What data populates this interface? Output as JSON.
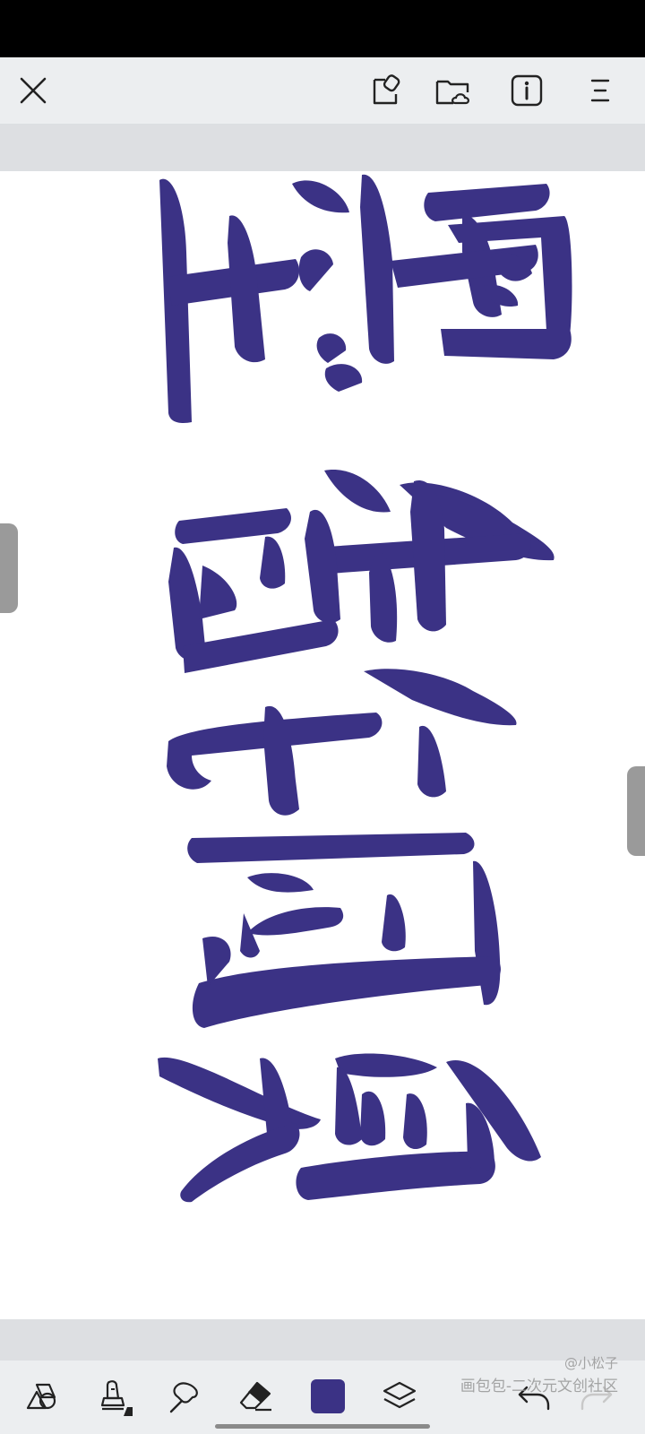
{
  "top_toolbar": {
    "icons": [
      "close-icon",
      "share-icon",
      "cloud-folder-icon",
      "info-icon",
      "menu-icon"
    ]
  },
  "bottom_toolbar": {
    "tools": [
      "shapes-icon",
      "brush-icon",
      "smudge-icon",
      "eraser-icon",
      "color-swatch",
      "layers-icon",
      "undo-icon",
      "redo-icon"
    ],
    "current_color": "#3b3285"
  },
  "watermark": {
    "handle": "@小松子",
    "site": "画包包-二次元文创社区"
  },
  "colors": {
    "ink": "#3b3285",
    "toolbar_bg": "#eceef0",
    "band_bg": "#dddfe2"
  }
}
